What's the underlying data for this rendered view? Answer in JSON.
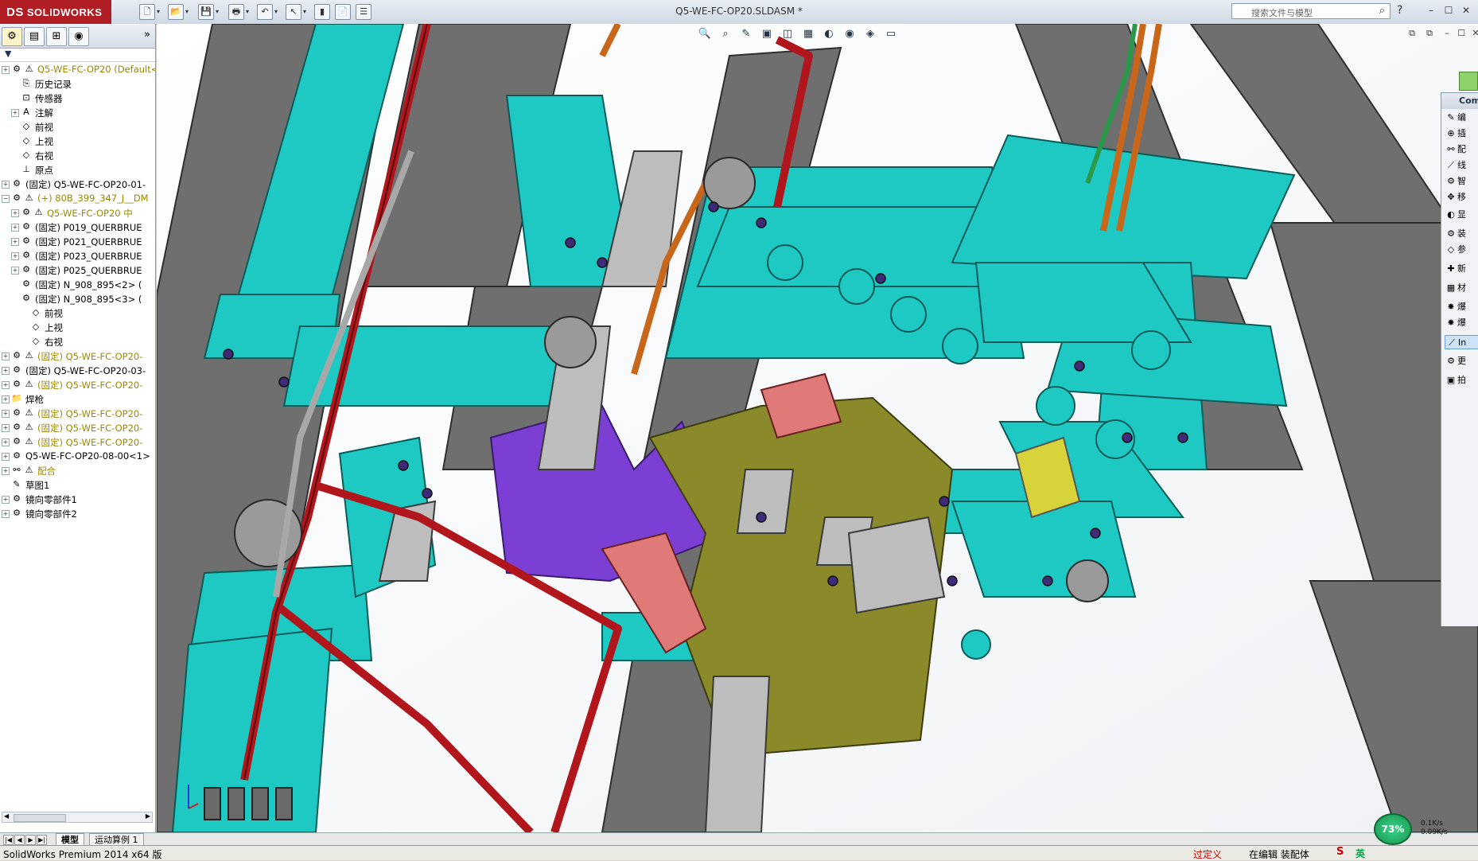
{
  "app": {
    "logo_text": "SOLIDWORKS",
    "logo_mark": "DS",
    "window_title": "Q5-WE-FC-OP20.SLDASM *",
    "search_placeholder": "搜索文件与模型",
    "help_glyph": "?",
    "window_buttons": [
      "–",
      "☐",
      "✕"
    ],
    "doc_buttons": [
      "⧉",
      "⧉",
      "–",
      "☐",
      "✕"
    ]
  },
  "toolbar": {
    "icons": [
      "new-icon",
      "open-icon",
      "save-icon",
      "print-icon",
      "undo-icon",
      "select-icon",
      "rebuild-icon",
      "file-properties-icon",
      "options-icon"
    ],
    "glyphs": [
      "🗋",
      "📂",
      "💾",
      "🖶",
      "↶",
      "↖",
      "▮",
      "📄",
      "☰"
    ]
  },
  "left_tabs": {
    "glyphs": [
      "⚙",
      "▤",
      "⊞",
      "◉"
    ],
    "expand": "»"
  },
  "tree": [
    {
      "indent": 0,
      "exp": "+",
      "icon": "⚙",
      "warn": true,
      "label": "Q5-WE-FC-OP20  (Default<",
      "style": "olive"
    },
    {
      "indent": 1,
      "exp": "",
      "icon": "⎘",
      "warn": false,
      "label": "历史记录",
      "style": ""
    },
    {
      "indent": 1,
      "exp": "",
      "icon": "⊡",
      "warn": false,
      "label": "传感器",
      "style": ""
    },
    {
      "indent": 1,
      "exp": "+",
      "icon": "A",
      "warn": false,
      "label": "注解",
      "style": ""
    },
    {
      "indent": 1,
      "exp": "",
      "icon": "◇",
      "warn": false,
      "label": "前视",
      "style": ""
    },
    {
      "indent": 1,
      "exp": "",
      "icon": "◇",
      "warn": false,
      "label": "上视",
      "style": ""
    },
    {
      "indent": 1,
      "exp": "",
      "icon": "◇",
      "warn": false,
      "label": "右视",
      "style": ""
    },
    {
      "indent": 1,
      "exp": "",
      "icon": "⊥",
      "warn": false,
      "label": "原点",
      "style": ""
    },
    {
      "indent": 0,
      "exp": "+",
      "icon": "⚙",
      "warn": false,
      "label": "(固定) Q5-WE-FC-OP20-01-",
      "style": ""
    },
    {
      "indent": 0,
      "exp": "−",
      "icon": "⚙",
      "warn": true,
      "label": "(+) 80B_399_347_J__DM",
      "style": "olive"
    },
    {
      "indent": 1,
      "exp": "+",
      "icon": "⚙",
      "warn": true,
      "label": "Q5-WE-FC-OP20 中",
      "style": "olive"
    },
    {
      "indent": 1,
      "exp": "+",
      "icon": "⚙",
      "warn": false,
      "label": "(固定) P019_QUERBRUE",
      "style": ""
    },
    {
      "indent": 1,
      "exp": "+",
      "icon": "⚙",
      "warn": false,
      "label": "(固定) P021_QUERBRUE",
      "style": ""
    },
    {
      "indent": 1,
      "exp": "+",
      "icon": "⚙",
      "warn": false,
      "label": "(固定) P023_QUERBRUE",
      "style": ""
    },
    {
      "indent": 1,
      "exp": "+",
      "icon": "⚙",
      "warn": false,
      "label": "(固定) P025_QUERBRUE",
      "style": ""
    },
    {
      "indent": 1,
      "exp": "",
      "icon": "⚙",
      "warn": false,
      "label": "(固定) N_908_895<2> (",
      "style": ""
    },
    {
      "indent": 1,
      "exp": "",
      "icon": "⚙",
      "warn": false,
      "label": "(固定) N_908_895<3> (",
      "style": ""
    },
    {
      "indent": 2,
      "exp": "",
      "icon": "◇",
      "warn": false,
      "label": "前视",
      "style": ""
    },
    {
      "indent": 2,
      "exp": "",
      "icon": "◇",
      "warn": false,
      "label": "上视",
      "style": ""
    },
    {
      "indent": 2,
      "exp": "",
      "icon": "◇",
      "warn": false,
      "label": "右视",
      "style": ""
    },
    {
      "indent": 0,
      "exp": "+",
      "icon": "⚙",
      "warn": true,
      "label": "(固定) Q5-WE-FC-OP20-",
      "style": "olive"
    },
    {
      "indent": 0,
      "exp": "+",
      "icon": "⚙",
      "warn": false,
      "label": "(固定) Q5-WE-FC-OP20-03-",
      "style": ""
    },
    {
      "indent": 0,
      "exp": "+",
      "icon": "⚙",
      "warn": true,
      "label": "(固定) Q5-WE-FC-OP20-",
      "style": "olive"
    },
    {
      "indent": 0,
      "exp": "+",
      "icon": "📁",
      "warn": false,
      "label": "焊枪",
      "style": ""
    },
    {
      "indent": 0,
      "exp": "+",
      "icon": "⚙",
      "warn": true,
      "label": "(固定) Q5-WE-FC-OP20-",
      "style": "olive"
    },
    {
      "indent": 0,
      "exp": "+",
      "icon": "⚙",
      "warn": true,
      "label": "(固定) Q5-WE-FC-OP20-",
      "style": "olive"
    },
    {
      "indent": 0,
      "exp": "+",
      "icon": "⚙",
      "warn": true,
      "label": "(固定) Q5-WE-FC-OP20-",
      "style": "olive"
    },
    {
      "indent": 0,
      "exp": "+",
      "icon": "⚙",
      "warn": false,
      "label": "Q5-WE-FC-OP20-08-00<1>",
      "style": ""
    },
    {
      "indent": 0,
      "exp": "+",
      "icon": "⚯",
      "warn": true,
      "label": "配合",
      "style": "olive"
    },
    {
      "indent": 0,
      "exp": "",
      "icon": "✎",
      "warn": false,
      "label": "草图1",
      "style": ""
    },
    {
      "indent": 0,
      "exp": "+",
      "icon": "⚙",
      "warn": false,
      "label": "镜向零部件1",
      "style": ""
    },
    {
      "indent": 0,
      "exp": "+",
      "icon": "⚙",
      "warn": false,
      "label": "镜向零部件2",
      "style": ""
    }
  ],
  "bottom_tabs": {
    "nav": [
      "|◀",
      "◀",
      "▶",
      "▶|"
    ],
    "tabs": [
      "模型",
      "运动算例 1"
    ]
  },
  "status": {
    "app_name": "SolidWorks Premium 2014 x64 版",
    "overdefined": "过定义",
    "editing": "在编辑 装配体",
    "ime_logo": "S",
    "ime_lang": "英",
    "perf_percent": "73%",
    "net_up": "0.1K/s",
    "net_down": "0.09K/s"
  },
  "task_pane": {
    "header": "Com",
    "items": [
      {
        "icon": "✎",
        "label": "编",
        "selected": false
      },
      {
        "icon": "⊕",
        "label": "插",
        "selected": false
      },
      {
        "icon": "⚯",
        "label": "配",
        "selected": false
      },
      {
        "icon": "⟋",
        "label": "线",
        "selected": false
      },
      {
        "icon": "⚙",
        "label": "智",
        "selected": false
      },
      {
        "icon": "✥",
        "label": "移",
        "selected": false
      },
      {
        "icon": "◐",
        "label": "显",
        "selected": false
      },
      {
        "icon": "⚙",
        "label": "装",
        "selected": false
      },
      {
        "icon": "◇",
        "label": "参",
        "selected": false
      },
      {
        "icon": "✚",
        "label": "新",
        "selected": false
      },
      {
        "icon": "▦",
        "label": "材",
        "selected": false
      },
      {
        "icon": "✸",
        "label": "爆",
        "selected": false
      },
      {
        "icon": "✸",
        "label": "爆",
        "selected": false
      },
      {
        "icon": "⟋",
        "label": "In",
        "selected": true
      },
      {
        "icon": "⚙",
        "label": "更",
        "selected": false
      },
      {
        "icon": "▣",
        "label": "拍",
        "selected": false
      }
    ]
  },
  "heads_up": {
    "glyphs": [
      "🔍",
      "⌕",
      "✎",
      "▣",
      "◫",
      "▦",
      "◐",
      "◉",
      "◈",
      "▭"
    ]
  },
  "colors": {
    "teal": "#1fc9c3",
    "teal_dark": "#0d8f8a",
    "gray": "#6f6f70",
    "gray_dark": "#4a4a4b",
    "purple": "#7b3fd4",
    "red_pipe": "#b0161c",
    "salmon": "#e07a78",
    "olive": "#8a8a2a",
    "copper": "#c8661a",
    "yellow": "#d8d33a"
  }
}
